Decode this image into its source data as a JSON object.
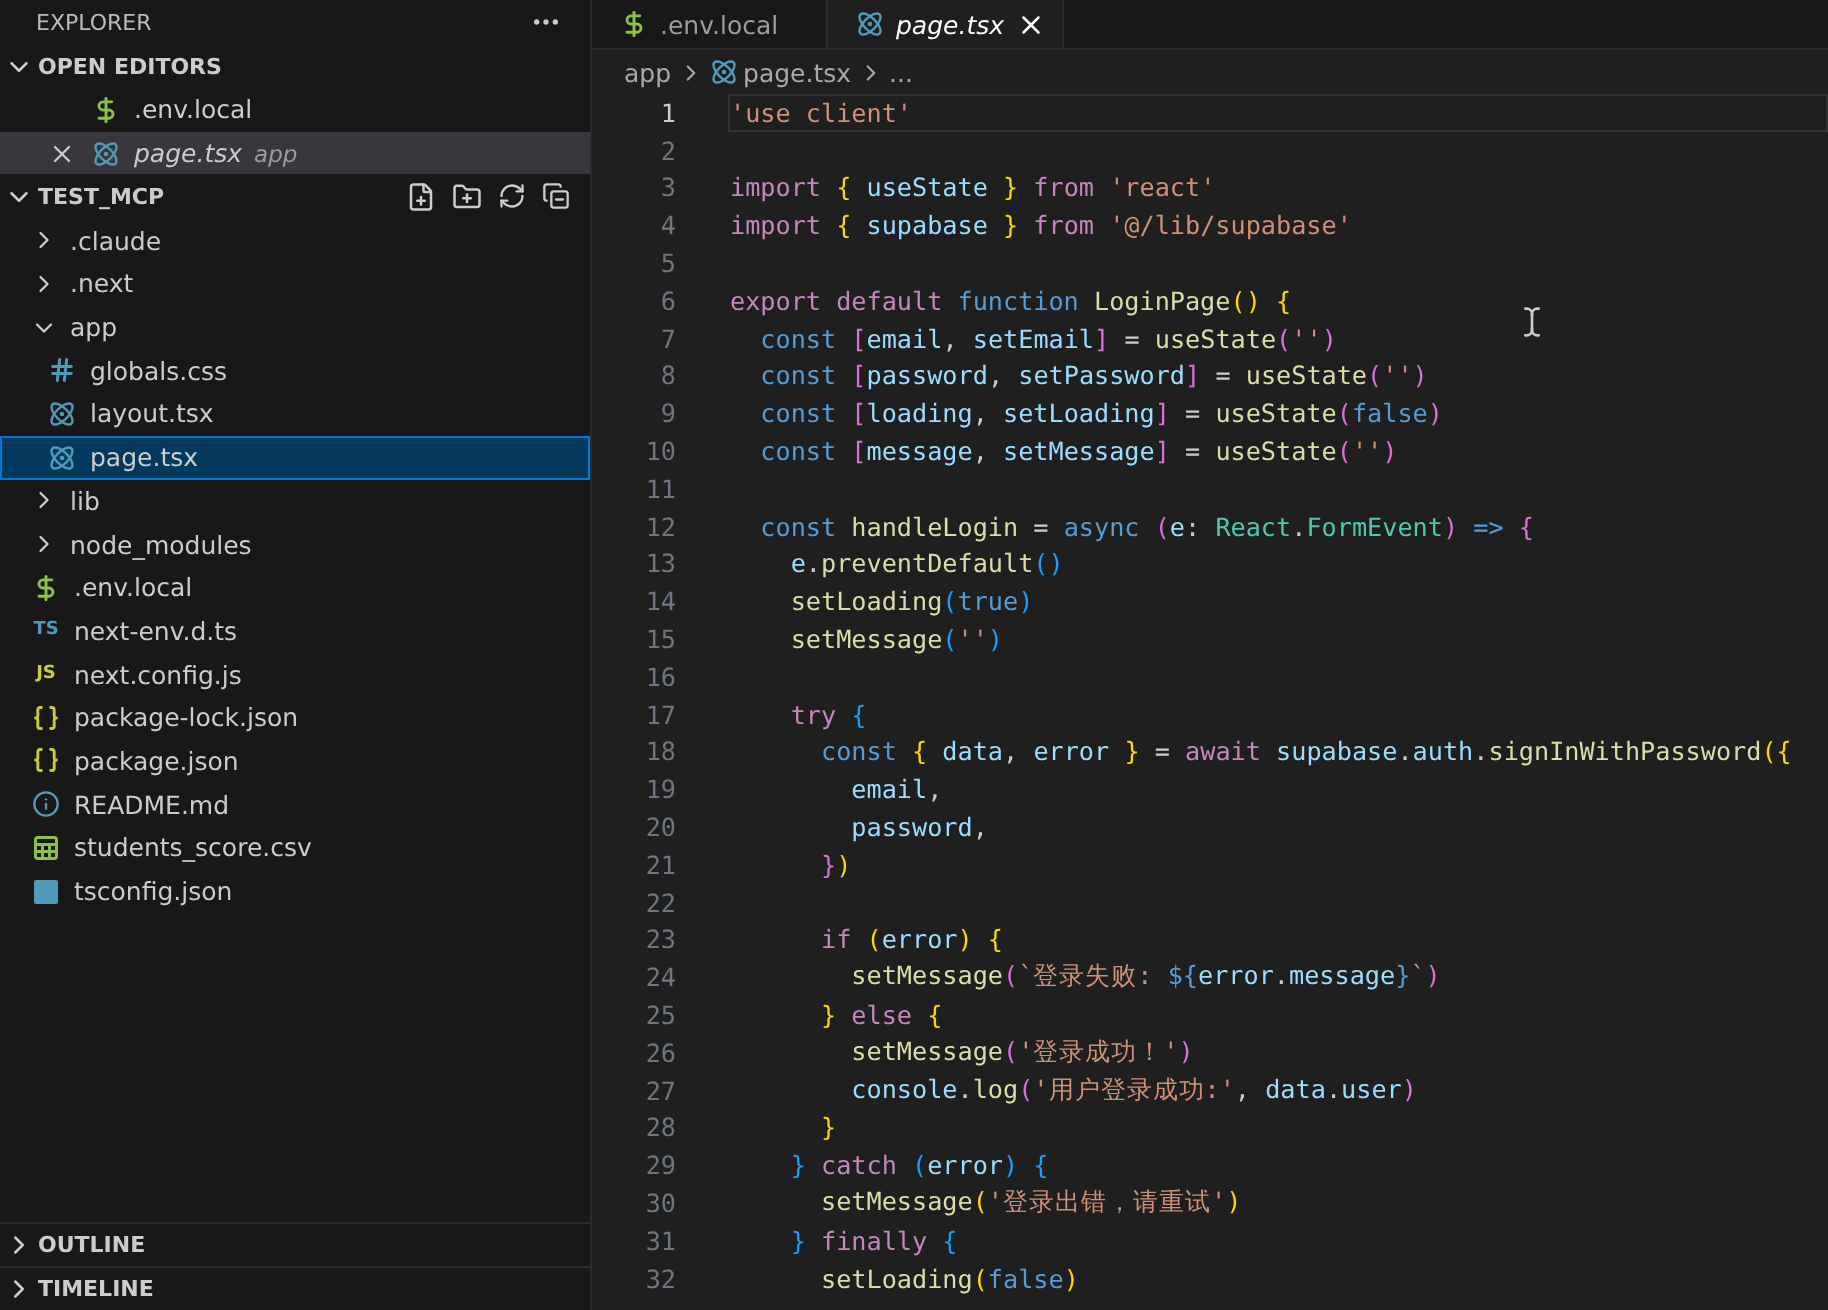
{
  "sidebar": {
    "title": "EXPLORER",
    "open_editors": {
      "title": "OPEN EDITORS",
      "expanded": true,
      "items": [
        {
          "name": ".env.local",
          "kind": "env",
          "selected": false,
          "closable": false,
          "preview": false
        },
        {
          "name": "page.tsx",
          "detail": "app",
          "kind": "react",
          "selected": true,
          "closable": true,
          "preview": true
        }
      ]
    },
    "project": {
      "title": "TEST_MCP",
      "expanded": true,
      "tree": [
        {
          "name": ".claude",
          "kind": "folder",
          "expanded": false,
          "selected": false
        },
        {
          "name": ".next",
          "kind": "folder",
          "expanded": false,
          "selected": false
        },
        {
          "name": "app",
          "kind": "folder",
          "expanded": true,
          "selected": false,
          "children": [
            {
              "name": "globals.css",
              "kind": "css",
              "selected": false
            },
            {
              "name": "layout.tsx",
              "kind": "react",
              "selected": false
            },
            {
              "name": "page.tsx",
              "kind": "react",
              "selected": true
            }
          ]
        },
        {
          "name": "lib",
          "kind": "folder",
          "expanded": false,
          "selected": false
        },
        {
          "name": "node_modules",
          "kind": "folder",
          "expanded": false,
          "selected": false
        },
        {
          "name": ".env.local",
          "kind": "env",
          "selected": false
        },
        {
          "name": "next-env.d.ts",
          "kind": "ts",
          "badge": "TS",
          "selected": false
        },
        {
          "name": "next.config.js",
          "kind": "js",
          "badge": "JS",
          "selected": false
        },
        {
          "name": "package-lock.json",
          "kind": "json",
          "selected": false
        },
        {
          "name": "package.json",
          "kind": "json",
          "selected": false
        },
        {
          "name": "README.md",
          "kind": "info",
          "selected": false
        },
        {
          "name": "students_score.csv",
          "kind": "csv",
          "selected": false
        },
        {
          "name": "tsconfig.json",
          "kind": "tsconfig",
          "selected": false
        }
      ]
    },
    "outline": {
      "title": "OUTLINE",
      "expanded": false
    },
    "timeline": {
      "title": "TIMELINE",
      "expanded": false
    }
  },
  "tabs": [
    {
      "label": ".env.local",
      "kind": "env",
      "selected": false,
      "preview": false
    },
    {
      "label": "page.tsx",
      "kind": "react",
      "selected": true,
      "preview": true
    }
  ],
  "breadcrumb": [
    {
      "label": "app",
      "kind": "folder"
    },
    {
      "label": "page.tsx",
      "kind": "react"
    },
    {
      "label": "...",
      "kind": "more"
    }
  ],
  "editor": {
    "lines": [
      {
        "number": "1",
        "current": true,
        "tokens": [
          {
            "kind": "str",
            "text": "'use client'"
          }
        ]
      },
      {
        "number": "2",
        "current": false
      },
      {
        "number": "3",
        "current": false,
        "tokens": [
          {
            "kind": "kw",
            "text": "import "
          },
          {
            "kind": "b1",
            "text": "{ "
          },
          {
            "kind": "var",
            "text": "useState "
          },
          {
            "kind": "b1",
            "text": "} "
          },
          {
            "kind": "kw",
            "text": "from "
          },
          {
            "kind": "str",
            "text": "'react'"
          }
        ]
      },
      {
        "number": "4",
        "current": false,
        "tokens": [
          {
            "kind": "kw",
            "text": "import "
          },
          {
            "kind": "b1",
            "text": "{ "
          },
          {
            "kind": "var",
            "text": "supabase "
          },
          {
            "kind": "b1",
            "text": "} "
          },
          {
            "kind": "kw",
            "text": "from "
          },
          {
            "kind": "str",
            "text": "'@/lib/supabase'"
          }
        ]
      },
      {
        "number": "5",
        "current": false
      },
      {
        "number": "6",
        "current": false,
        "tokens": [
          {
            "kind": "kw",
            "text": "export default "
          },
          {
            "kind": "st",
            "text": "function "
          },
          {
            "kind": "fn",
            "text": "LoginPage"
          },
          {
            "kind": "b1",
            "text": "() {"
          }
        ]
      },
      {
        "number": "7",
        "current": false,
        "tokens": [
          {
            "kind": "st",
            "text": "  const "
          },
          {
            "kind": "b2",
            "text": "["
          },
          {
            "kind": "var",
            "text": "email"
          },
          {
            "kind": "p",
            "text": ", "
          },
          {
            "kind": "var",
            "text": "setEmail"
          },
          {
            "kind": "b2",
            "text": "]"
          },
          {
            "kind": "p",
            "text": " = "
          },
          {
            "kind": "fn",
            "text": "useState"
          },
          {
            "kind": "b2",
            "text": "("
          },
          {
            "kind": "str",
            "text": "''"
          },
          {
            "kind": "b2",
            "text": ")"
          }
        ]
      },
      {
        "number": "8",
        "current": false,
        "tokens": [
          {
            "kind": "st",
            "text": "  const "
          },
          {
            "kind": "b2",
            "text": "["
          },
          {
            "kind": "var",
            "text": "password"
          },
          {
            "kind": "p",
            "text": ", "
          },
          {
            "kind": "var",
            "text": "setPassword"
          },
          {
            "kind": "b2",
            "text": "]"
          },
          {
            "kind": "p",
            "text": " = "
          },
          {
            "kind": "fn",
            "text": "useState"
          },
          {
            "kind": "b2",
            "text": "("
          },
          {
            "kind": "str",
            "text": "''"
          },
          {
            "kind": "b2",
            "text": ")"
          }
        ]
      },
      {
        "number": "9",
        "current": false,
        "tokens": [
          {
            "kind": "st",
            "text": "  const "
          },
          {
            "kind": "b2",
            "text": "["
          },
          {
            "kind": "var",
            "text": "loading"
          },
          {
            "kind": "p",
            "text": ", "
          },
          {
            "kind": "var",
            "text": "setLoading"
          },
          {
            "kind": "b2",
            "text": "]"
          },
          {
            "kind": "p",
            "text": " = "
          },
          {
            "kind": "fn",
            "text": "useState"
          },
          {
            "kind": "b2",
            "text": "("
          },
          {
            "kind": "st",
            "text": "false"
          },
          {
            "kind": "b2",
            "text": ")"
          }
        ]
      },
      {
        "number": "10",
        "current": false,
        "tokens": [
          {
            "kind": "st",
            "text": "  const "
          },
          {
            "kind": "b2",
            "text": "["
          },
          {
            "kind": "var",
            "text": "message"
          },
          {
            "kind": "p",
            "text": ", "
          },
          {
            "kind": "var",
            "text": "setMessage"
          },
          {
            "kind": "b2",
            "text": "]"
          },
          {
            "kind": "p",
            "text": " = "
          },
          {
            "kind": "fn",
            "text": "useState"
          },
          {
            "kind": "b2",
            "text": "("
          },
          {
            "kind": "str",
            "text": "''"
          },
          {
            "kind": "b2",
            "text": ")"
          }
        ]
      },
      {
        "number": "11",
        "current": false
      },
      {
        "number": "12",
        "current": false,
        "tokens": [
          {
            "kind": "st",
            "text": "  const "
          },
          {
            "kind": "fn",
            "text": "handleLogin"
          },
          {
            "kind": "p",
            "text": " = "
          },
          {
            "kind": "st",
            "text": "async "
          },
          {
            "kind": "b2",
            "text": "("
          },
          {
            "kind": "var",
            "text": "e"
          },
          {
            "kind": "p",
            "text": ": "
          },
          {
            "kind": "type",
            "text": "React"
          },
          {
            "kind": "p",
            "text": "."
          },
          {
            "kind": "type",
            "text": "FormEvent"
          },
          {
            "kind": "b2",
            "text": ")"
          },
          {
            "kind": "st",
            "text": " => "
          },
          {
            "kind": "b2",
            "text": "{"
          }
        ]
      },
      {
        "number": "13",
        "current": false,
        "tokens": [
          {
            "kind": "var",
            "text": "    e"
          },
          {
            "kind": "p",
            "text": "."
          },
          {
            "kind": "fn",
            "text": "preventDefault"
          },
          {
            "kind": "b3",
            "text": "()"
          }
        ]
      },
      {
        "number": "14",
        "current": false,
        "tokens": [
          {
            "kind": "fn",
            "text": "    setLoading"
          },
          {
            "kind": "b3",
            "text": "("
          },
          {
            "kind": "st",
            "text": "true"
          },
          {
            "kind": "b3",
            "text": ")"
          }
        ]
      },
      {
        "number": "15",
        "current": false,
        "tokens": [
          {
            "kind": "fn",
            "text": "    setMessage"
          },
          {
            "kind": "b3",
            "text": "("
          },
          {
            "kind": "str",
            "text": "''"
          },
          {
            "kind": "b3",
            "text": ")"
          }
        ]
      },
      {
        "number": "16",
        "current": false
      },
      {
        "number": "17",
        "current": false,
        "tokens": [
          {
            "kind": "kw",
            "text": "    try "
          },
          {
            "kind": "b3",
            "text": "{"
          }
        ]
      },
      {
        "number": "18",
        "current": false,
        "tokens": [
          {
            "kind": "st",
            "text": "      const "
          },
          {
            "kind": "b1",
            "text": "{ "
          },
          {
            "kind": "var",
            "text": "data"
          },
          {
            "kind": "p",
            "text": ", "
          },
          {
            "kind": "var",
            "text": "error "
          },
          {
            "kind": "b1",
            "text": "}"
          },
          {
            "kind": "p",
            "text": " = "
          },
          {
            "kind": "kw",
            "text": "await "
          },
          {
            "kind": "var",
            "text": "supabase"
          },
          {
            "kind": "p",
            "text": "."
          },
          {
            "kind": "var",
            "text": "auth"
          },
          {
            "kind": "p",
            "text": "."
          },
          {
            "kind": "fn",
            "text": "signInWithPassword"
          },
          {
            "kind": "b1",
            "text": "({"
          }
        ]
      },
      {
        "number": "19",
        "current": false,
        "tokens": [
          {
            "kind": "var",
            "text": "        email"
          },
          {
            "kind": "p",
            "text": ","
          }
        ]
      },
      {
        "number": "20",
        "current": false,
        "tokens": [
          {
            "kind": "var",
            "text": "        password"
          },
          {
            "kind": "p",
            "text": ","
          }
        ]
      },
      {
        "number": "21",
        "current": false,
        "tokens": [
          {
            "kind": "b2",
            "text": "      }"
          },
          {
            "kind": "b1",
            "text": ")"
          }
        ]
      },
      {
        "number": "22",
        "current": false
      },
      {
        "number": "23",
        "current": false,
        "tokens": [
          {
            "kind": "kw",
            "text": "      if "
          },
          {
            "kind": "b1",
            "text": "("
          },
          {
            "kind": "var",
            "text": "error"
          },
          {
            "kind": "b1",
            "text": ") {"
          }
        ]
      },
      {
        "number": "24",
        "current": false,
        "tokens": [
          {
            "kind": "fn",
            "text": "        setMessage"
          },
          {
            "kind": "b2",
            "text": "("
          },
          {
            "kind": "str",
            "text": "`登录失败: "
          },
          {
            "kind": "st",
            "text": "${"
          },
          {
            "kind": "var",
            "text": "error"
          },
          {
            "kind": "p",
            "text": "."
          },
          {
            "kind": "var",
            "text": "message"
          },
          {
            "kind": "st",
            "text": "}"
          },
          {
            "kind": "str",
            "text": "`"
          },
          {
            "kind": "b2",
            "text": ")"
          }
        ]
      },
      {
        "number": "25",
        "current": false,
        "tokens": [
          {
            "kind": "b1",
            "text": "      } "
          },
          {
            "kind": "kw",
            "text": "else "
          },
          {
            "kind": "b1",
            "text": "{"
          }
        ]
      },
      {
        "number": "26",
        "current": false,
        "tokens": [
          {
            "kind": "fn",
            "text": "        setMessage"
          },
          {
            "kind": "b2",
            "text": "("
          },
          {
            "kind": "str",
            "text": "'登录成功！'"
          },
          {
            "kind": "b2",
            "text": ")"
          }
        ]
      },
      {
        "number": "27",
        "current": false,
        "tokens": [
          {
            "kind": "var",
            "text": "        console"
          },
          {
            "kind": "p",
            "text": "."
          },
          {
            "kind": "fn",
            "text": "log"
          },
          {
            "kind": "b2",
            "text": "("
          },
          {
            "kind": "str",
            "text": "'用户登录成功:'"
          },
          {
            "kind": "p",
            "text": ", "
          },
          {
            "kind": "var",
            "text": "data"
          },
          {
            "kind": "p",
            "text": "."
          },
          {
            "kind": "var",
            "text": "user"
          },
          {
            "kind": "b2",
            "text": ")"
          }
        ]
      },
      {
        "number": "28",
        "current": false,
        "tokens": [
          {
            "kind": "b1",
            "text": "      }"
          }
        ]
      },
      {
        "number": "29",
        "current": false,
        "tokens": [
          {
            "kind": "b3",
            "text": "    } "
          },
          {
            "kind": "kw",
            "text": "catch "
          },
          {
            "kind": "b3",
            "text": "("
          },
          {
            "kind": "var",
            "text": "error"
          },
          {
            "kind": "b3",
            "text": ") {"
          }
        ]
      },
      {
        "number": "30",
        "current": false,
        "tokens": [
          {
            "kind": "fn",
            "text": "      setMessage"
          },
          {
            "kind": "b1",
            "text": "("
          },
          {
            "kind": "str",
            "text": "'登录出错，请重试'"
          },
          {
            "kind": "b1",
            "text": ")"
          }
        ]
      },
      {
        "number": "31",
        "current": false,
        "tokens": [
          {
            "kind": "b3",
            "text": "    } "
          },
          {
            "kind": "kw",
            "text": "finally "
          },
          {
            "kind": "b3",
            "text": "{"
          }
        ]
      },
      {
        "number": "32",
        "current": false,
        "tokens": [
          {
            "kind": "fn",
            "text": "      setLoading"
          },
          {
            "kind": "b1",
            "text": "("
          },
          {
            "kind": "st",
            "text": "false"
          },
          {
            "kind": "b1",
            "text": ")"
          }
        ]
      }
    ]
  }
}
